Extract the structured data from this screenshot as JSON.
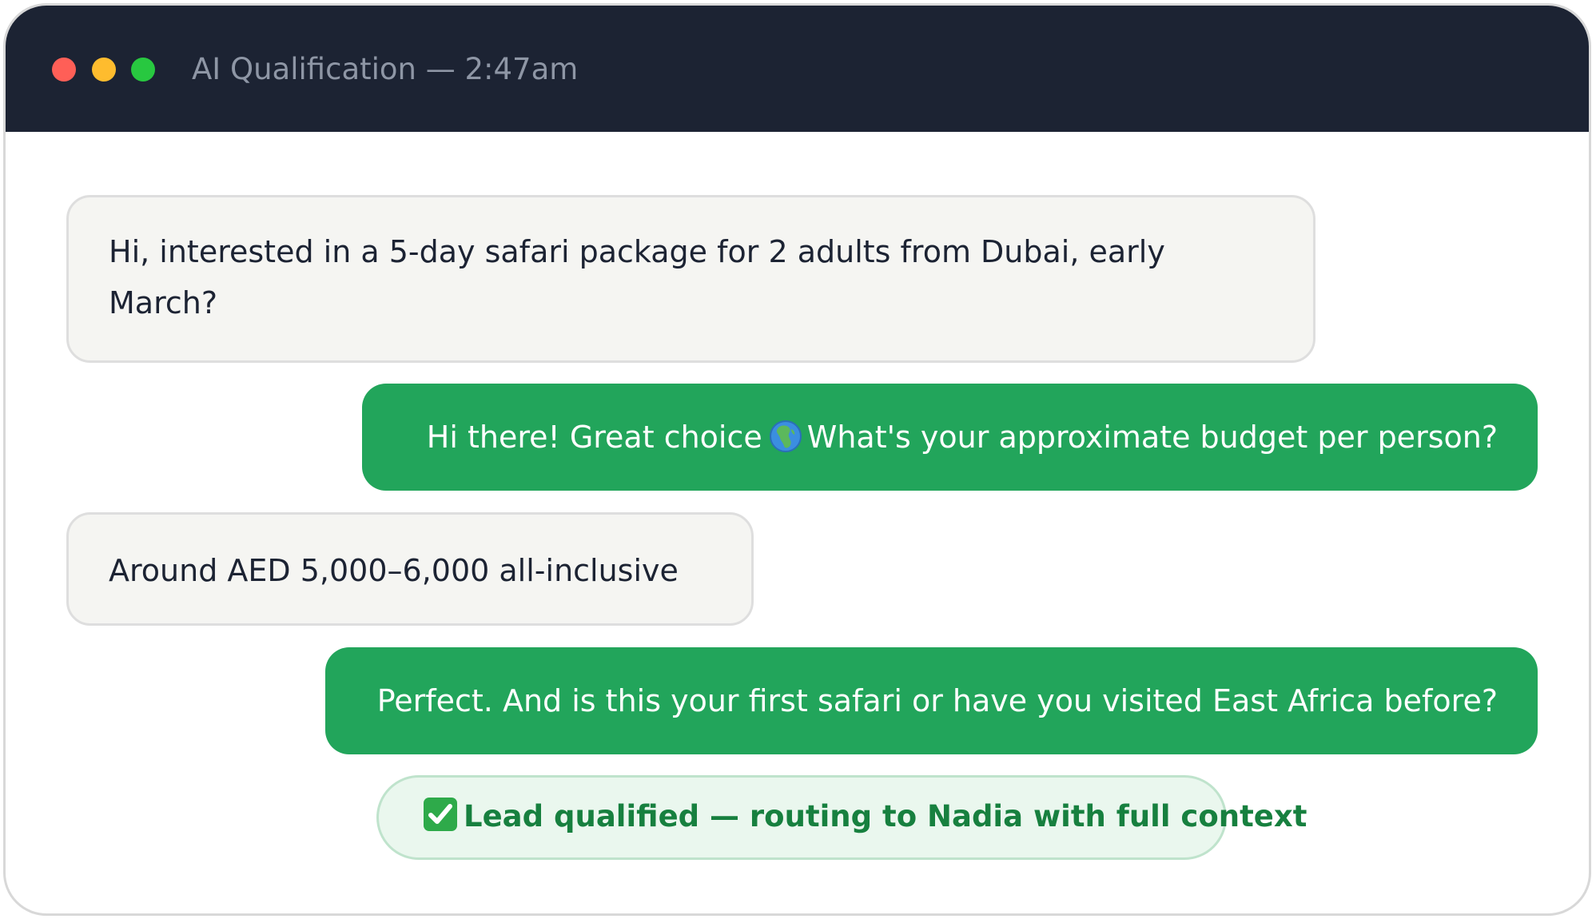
{
  "window": {
    "title": "AI Qualification — 2:47am",
    "controls": [
      {
        "name": "close",
        "color": "#ff5f57"
      },
      {
        "name": "minimize",
        "color": "#febc2e"
      },
      {
        "name": "maximize",
        "color": "#28c840"
      }
    ]
  },
  "conversation": {
    "messages": [
      {
        "sender": "user",
        "text": "Hi, interested in a 5-day safari package for 2 adults from Dubai, early March?"
      },
      {
        "sender": "assistant",
        "text_before_icon": "Hi there! Great choice",
        "icon": "globe-africa-icon",
        "text_after_icon": "What's your approximate budget per person?"
      },
      {
        "sender": "user",
        "text": "Around AED 5,000–6,000 all-inclusive"
      },
      {
        "sender": "assistant",
        "text": "Perfect. And is this your first safari or have you visited East Africa before?"
      }
    ],
    "status": {
      "icon": "check-mark-button-icon",
      "text": "Lead qualified — routing to Nadia with full context"
    }
  },
  "colors": {
    "titlebar": "#1c2333",
    "assistant_bubble": "#22a55b",
    "user_bubble": "#f5f5f2",
    "status_bg": "#eaf7ee",
    "status_text": "#17803f"
  }
}
